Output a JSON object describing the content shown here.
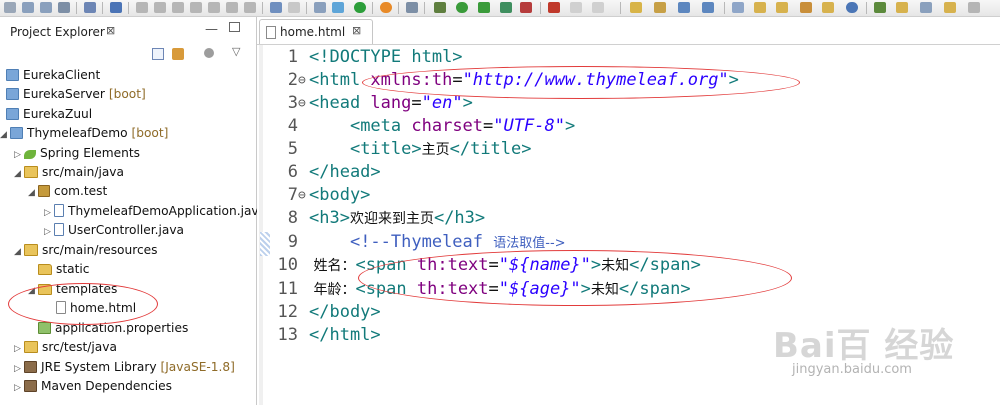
{
  "explorer": {
    "title": "Project Explorer",
    "close_glyph": "⊠",
    "min_glyph": "—",
    "items": [
      {
        "label": "EurekaClient",
        "suffix": ""
      },
      {
        "label": "EurekaServer",
        "suffix": "[boot]"
      },
      {
        "label": "EurekaZuul",
        "suffix": ""
      },
      {
        "label": "ThymeleafDemo",
        "suffix": "[boot]"
      },
      {
        "label": "Spring Elements",
        "suffix": ""
      },
      {
        "label": "src/main/java",
        "suffix": ""
      },
      {
        "label": "com.test",
        "suffix": ""
      },
      {
        "label": "ThymeleafDemoApplication.java",
        "suffix": ""
      },
      {
        "label": "UserController.java",
        "suffix": ""
      },
      {
        "label": "src/main/resources",
        "suffix": ""
      },
      {
        "label": "static",
        "suffix": ""
      },
      {
        "label": "templates",
        "suffix": ""
      },
      {
        "label": "home.html",
        "suffix": ""
      },
      {
        "label": "application.properties",
        "suffix": ""
      },
      {
        "label": "src/test/java",
        "suffix": ""
      },
      {
        "label": "JRE System Library",
        "suffix": "[JavaSE-1.8]"
      },
      {
        "label": "Maven Dependencies",
        "suffix": ""
      }
    ]
  },
  "editor": {
    "tab_label": "home.html",
    "tab_close_glyph": "⊠",
    "line_numbers": [
      "1",
      "2",
      "3",
      "4",
      "5",
      "6",
      "7",
      "8",
      "9",
      "10",
      "11",
      "12",
      "13"
    ],
    "fold_markers": [
      "",
      "⊖",
      "⊖",
      "",
      "",
      "",
      "⊖",
      "",
      "",
      "",
      "",
      "",
      ""
    ],
    "line1": {
      "lt": "<!DOCTYPE",
      "rest": " html>"
    },
    "line2": {
      "open": "<html",
      "attr": " xmlns:th",
      "eq": "=",
      "val": "\"http://www.thymeleaf.org\"",
      "close": ">"
    },
    "line3": {
      "open": "<head",
      "attr": " lang",
      "eq": "=",
      "val": "\"en\"",
      "close": ">"
    },
    "line4": {
      "indent": "    ",
      "open": "<meta",
      "attr": " charset",
      "eq": "=",
      "val": "\"UTF-8\"",
      "close": ">"
    },
    "line5": {
      "indent": "    ",
      "open": "<title>",
      "text": "主页",
      "close": "</title>"
    },
    "line6": {
      "close": "</head>"
    },
    "line7": {
      "open": "<body>"
    },
    "line8": {
      "open": "<h3>",
      "text": "欢迎来到主页",
      "close": "</h3>"
    },
    "line9": {
      "indent": "    ",
      "cmt": "<!--Thymeleaf ",
      "cmt_cn": "语法取值",
      "cmt_end": "-->"
    },
    "line10": {
      "label": " 姓名：",
      "open": "<span",
      "attr": " th:text",
      "eq": "=",
      "val": "\"${name}\"",
      "close": ">",
      "text": "未知",
      "end": "</span>"
    },
    "line11": {
      "label": " 年龄：",
      "open": "<span",
      "attr": " th:text",
      "eq": "=",
      "val": "\"${age}\"",
      "close": ">",
      "text": "未知",
      "end": "</span>"
    },
    "line12": {
      "close": "</body>"
    },
    "line13": {
      "close": "</html>"
    }
  },
  "watermark": {
    "brand": "Bai百 经验",
    "url": "jingyan.baidu.com"
  }
}
